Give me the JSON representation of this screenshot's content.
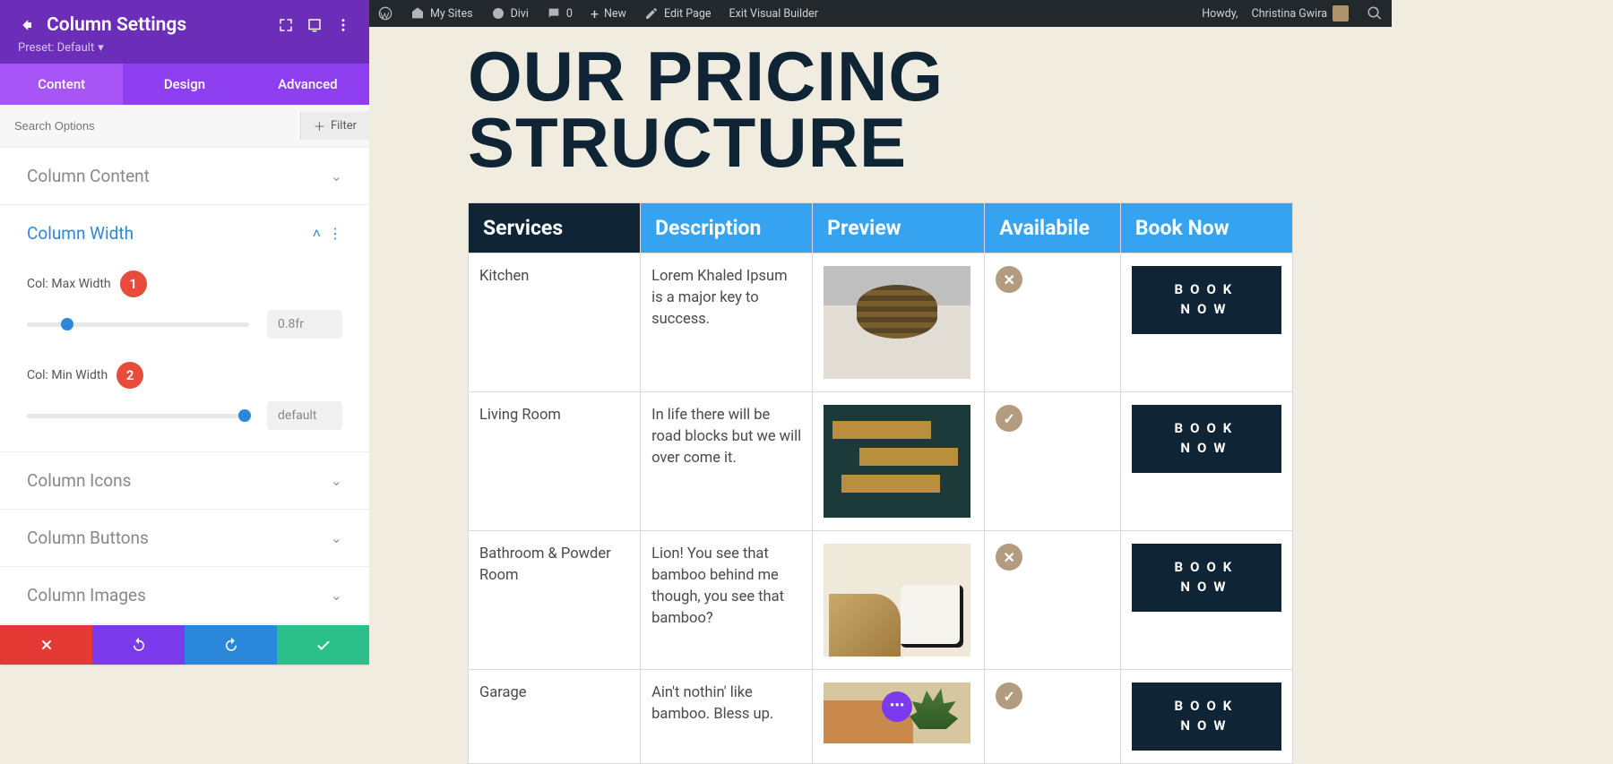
{
  "panel": {
    "title": "Column Settings",
    "preset_label": "Preset: Default",
    "tabs": {
      "content": "Content",
      "design": "Design",
      "advanced": "Advanced"
    },
    "search_placeholder": "Search Options",
    "filter_label": "Filter",
    "sections": {
      "column_content": "Column Content",
      "column_width": "Column Width",
      "column_icons": "Column Icons",
      "column_buttons": "Column Buttons",
      "column_images": "Column Images"
    },
    "width": {
      "max_label": "Col: Max Width",
      "max_value": "0.8fr",
      "min_label": "Col: Min Width",
      "min_value": "default"
    },
    "callouts": {
      "one": "1",
      "two": "2"
    }
  },
  "wpbar": {
    "my_sites": "My Sites",
    "divi": "Divi",
    "comments": "0",
    "new": "New",
    "edit_page": "Edit Page",
    "exit_vb": "Exit Visual Builder",
    "howdy_prefix": "Howdy,",
    "user_name": "Christina Gwira"
  },
  "page": {
    "heading": "OUR PRICING STRUCTURE",
    "headers": {
      "services": "Services",
      "description": "Description",
      "preview": "Preview",
      "available": "Availabile",
      "book": "Book Now"
    },
    "book_label": "BOOK NOW",
    "rows": [
      {
        "service": "Kitchen",
        "desc": "Lorem Khaled Ipsum is a major key to success.",
        "available": false
      },
      {
        "service": "Living Room",
        "desc": "In life there will be road blocks but we will over come it.",
        "available": true
      },
      {
        "service": "Bathroom & Powder Room",
        "desc": "Lion! You see that bamboo behind me though, you see that bamboo?",
        "available": false
      },
      {
        "service": "Garage",
        "desc": "Ain't nothin' like bamboo. Bless up.",
        "available": true
      }
    ]
  }
}
